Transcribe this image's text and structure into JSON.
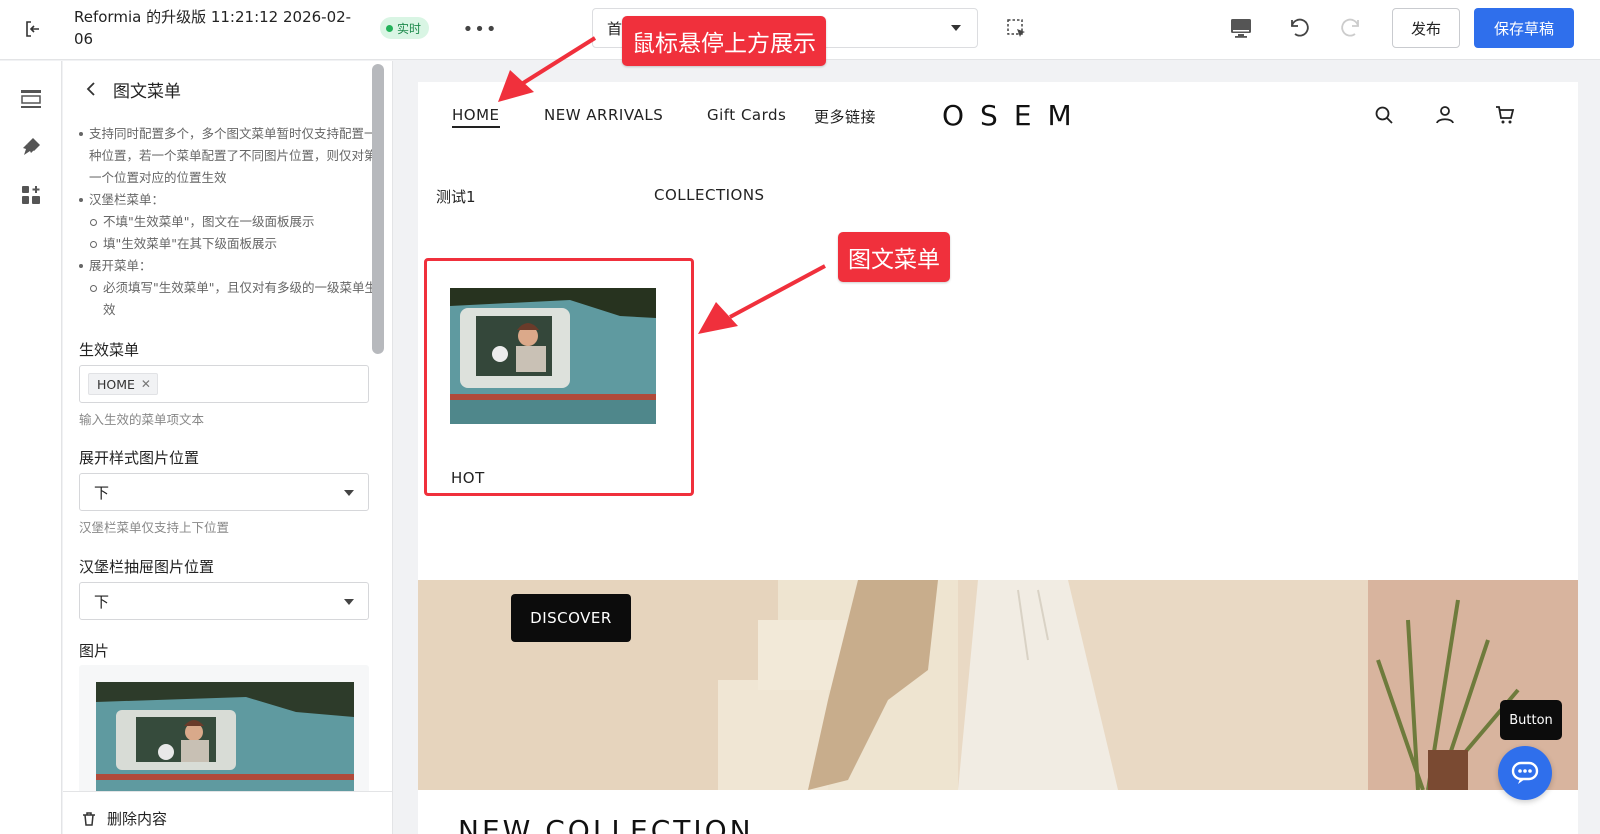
{
  "topbar": {
    "doc_title": "Reformia 的升级版 11:21:12 2026-02-06",
    "live_label": "实时",
    "page_select_value": "首",
    "publish_label": "发布",
    "save_label": "保存草稿"
  },
  "panel": {
    "title": "图文菜单",
    "help": {
      "b1": "支持同时配置多个，多个图文菜单暂时仅支持配置一种位置，若一个菜单配置了不同图片位置，则仅对第一个位置对应的位置生效",
      "b2": "汉堡栏菜单：",
      "b2a": "不填\"生效菜单\"，图文在一级面板展示",
      "b2b": "填\"生效菜单\"在其下级面板展示",
      "b3": "展开菜单：",
      "b3a": "必须填写\"生效菜单\"，且仅对有多级的一级菜单生效"
    },
    "effective_menu": {
      "label": "生效菜单",
      "tag": "HOME",
      "hint": "输入生效的菜单项文本"
    },
    "expand_position": {
      "label": "展开样式图片位置",
      "value": "下",
      "hint": "汉堡栏菜单仅支持上下位置"
    },
    "drawer_position": {
      "label": "汉堡栏抽屉图片位置",
      "value": "下"
    },
    "image": {
      "label": "图片"
    },
    "delete_label": "删除内容"
  },
  "store": {
    "nav": [
      "HOME",
      "NEW ARRIVALS",
      "Gift Cards",
      "更多链接"
    ],
    "logo": "OSEM",
    "mega_cols": [
      "测试1",
      "COLLECTIONS"
    ],
    "card_label": "HOT",
    "discover_label": "DISCOVER",
    "collection_heading": "NEW COLLECTION"
  },
  "annotations": {
    "hover_callout": "鼠标悬停上方展示",
    "menu_callout": "图文菜单"
  },
  "floating": {
    "button_label": "Button"
  },
  "colors": {
    "accent": "#2f6fec",
    "annotation": "#f0303c",
    "live_green": "#22b25a"
  }
}
